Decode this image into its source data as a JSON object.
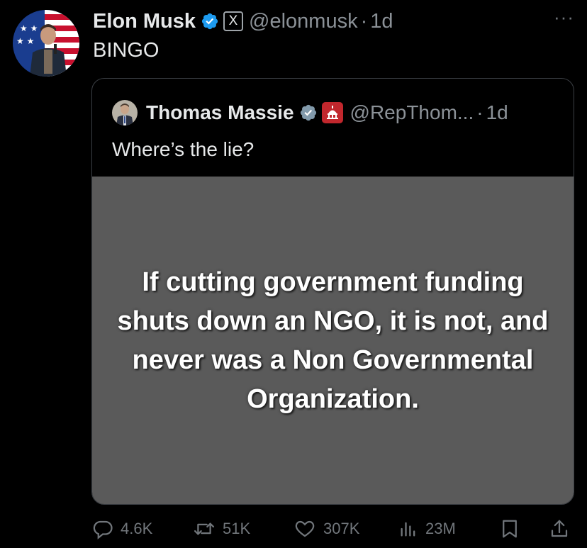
{
  "tweet": {
    "author_name": "Elon Musk",
    "author_handle": "@elonmusk",
    "separator": "·",
    "time": "1d",
    "text": "BINGO",
    "more_label": "···",
    "x_badge": "X"
  },
  "quote": {
    "author_name": "Thomas Massie",
    "author_handle": "@RepThom...",
    "separator": "·",
    "time": "1d",
    "text": "Where’s the lie?",
    "image_text": "If cutting government funding shuts down an NGO, it is not, and never was a Non Governmental Organization."
  },
  "actions": {
    "replies": "4.6K",
    "reposts": "51K",
    "likes": "307K",
    "views": "23M"
  },
  "icons": {
    "verified": "verified-badge-icon",
    "affiliate": "x-affiliate-badge-icon",
    "government": "capitol-dome-icon",
    "reply": "reply-icon",
    "repost": "repost-icon",
    "like": "heart-icon",
    "views": "analytics-icon",
    "bookmark": "bookmark-icon",
    "share": "share-icon"
  },
  "colors": {
    "background": "#000000",
    "text": "#e7e9ea",
    "muted": "#71767b",
    "verified": "#1d9bf0",
    "government_badge": "#c1272d",
    "quote_image_bg": "#5a5a5a"
  }
}
